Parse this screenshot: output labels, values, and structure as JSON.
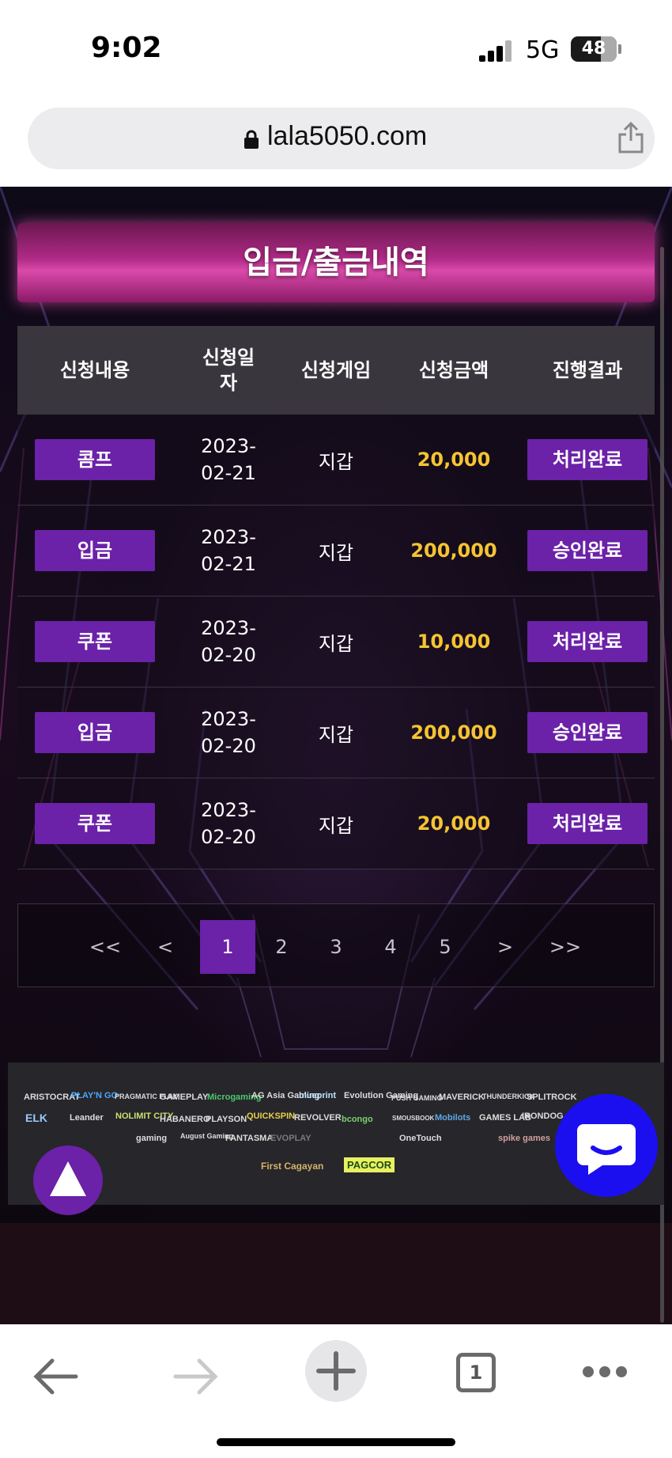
{
  "status_bar": {
    "time": "9:02",
    "network": "5G",
    "battery": "48"
  },
  "browser": {
    "url": "lala5050.com",
    "tab_count": "1"
  },
  "title": "입금/출금내역",
  "table": {
    "headers": [
      "신청내용",
      "신청일\n자",
      "신청게임",
      "신청금액",
      "진행결과"
    ],
    "rows": [
      {
        "type": "콤프",
        "date": "2023-\n02-21",
        "game": "지갑",
        "amount": "20,000",
        "status": "처리완료"
      },
      {
        "type": "입금",
        "date": "2023-\n02-21",
        "game": "지갑",
        "amount": "200,000",
        "status": "승인완료"
      },
      {
        "type": "쿠폰",
        "date": "2023-\n02-20",
        "game": "지갑",
        "amount": "10,000",
        "status": "처리완료"
      },
      {
        "type": "입금",
        "date": "2023-\n02-20",
        "game": "지갑",
        "amount": "200,000",
        "status": "승인완료"
      },
      {
        "type": "쿠폰",
        "date": "2023-\n02-20",
        "game": "지갑",
        "amount": "20,000",
        "status": "처리완료"
      }
    ]
  },
  "pagination": {
    "first": "<<",
    "prev": "<",
    "pages": [
      "1",
      "2",
      "3",
      "4",
      "5"
    ],
    "current": "1",
    "next": ">",
    "last": ">>"
  },
  "provider_logos": {
    "row1": [
      "ARISTOCRAT",
      "PLAY'N GO",
      "PRAGMATIC PLAY",
      "GAMEPLAY",
      "Microgaming",
      "AG Asia Gaming",
      "blueprint",
      "Evolution Gaming",
      "PUSH GAMING",
      "MAVERICK",
      "THUNDERKICK",
      "SPLITROCK"
    ],
    "row2": [
      "ELK",
      "Leander",
      "NOLIMIT CITY",
      "HABANERO",
      "PLAYSON",
      "QUICKSPIN",
      "REVOLVER",
      "bcongo",
      "SMOUSBOOK",
      "Mobilots",
      "GAMES LAB",
      "IRONDOG"
    ],
    "row3": [
      "gaming",
      "August Gaming",
      "FANTASMA",
      "EVOPLAY",
      "",
      "",
      "OneTouch",
      "",
      "spike games"
    ],
    "licensing": [
      "First Cagayan",
      "PAGCOR"
    ]
  },
  "colors": {
    "accent_purple": "#6b21a8",
    "amount_gold": "#f5c431",
    "chat_blue": "#1b0ff0",
    "banner_pink": "#c0308f"
  }
}
